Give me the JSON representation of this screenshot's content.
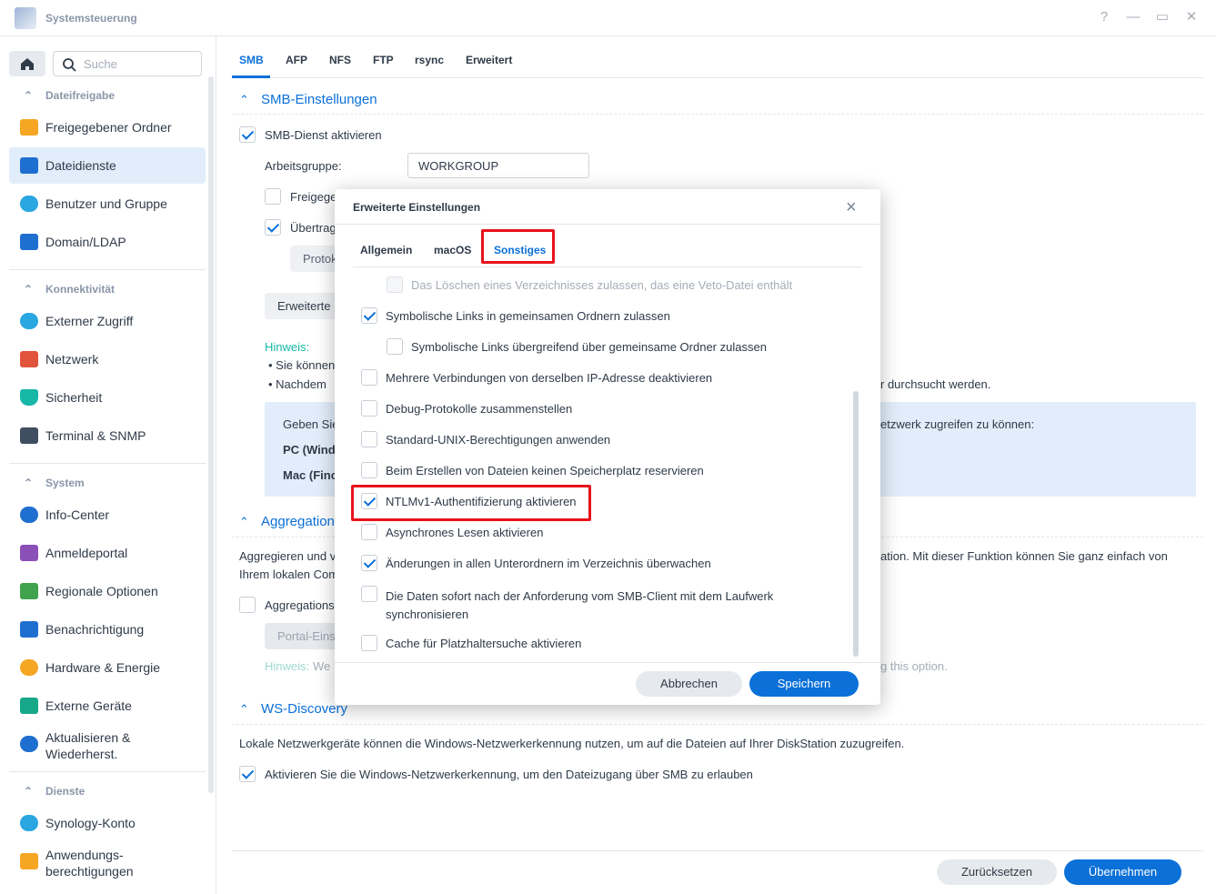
{
  "window": {
    "title": "Systemsteuerung",
    "controls": [
      "?",
      "—",
      "▭",
      "✕"
    ]
  },
  "sidebar": {
    "search_placeholder": "Suche",
    "sections": [
      {
        "label": "Dateifreigabe"
      },
      {
        "label": "Konnektivität"
      },
      {
        "label": "System"
      },
      {
        "label": "Dienste"
      }
    ],
    "items": [
      {
        "label": "Freigegebener Ordner",
        "icon": "folder-icon",
        "color": "#f5a623"
      },
      {
        "label": "Dateidienste",
        "icon": "file-services-icon",
        "color": "#1f6fd0"
      },
      {
        "label": "Benutzer und Gruppe",
        "icon": "users-icon",
        "color": "#2aa6e0"
      },
      {
        "label": "Domain/LDAP",
        "icon": "domain-icon",
        "color": "#1f6fd0"
      },
      {
        "label": "Externer Zugriff",
        "icon": "external-access-icon",
        "color": "#2aa6e0"
      },
      {
        "label": "Netzwerk",
        "icon": "network-home-icon",
        "color": "#e2533c"
      },
      {
        "label": "Sicherheit",
        "icon": "shield-icon",
        "color": "#17b8a6"
      },
      {
        "label": "Terminal & SNMP",
        "icon": "terminal-icon",
        "color": "#3f4e60"
      },
      {
        "label": "Info-Center",
        "icon": "info-icon",
        "color": "#1f6fd0"
      },
      {
        "label": "Anmeldeportal",
        "icon": "login-portal-icon",
        "color": "#8b4fb8"
      },
      {
        "label": "Regionale Optionen",
        "icon": "region-map-icon",
        "color": "#3fa34d"
      },
      {
        "label": "Benachrichtigung",
        "icon": "notification-icon",
        "color": "#1f6fd0"
      },
      {
        "label": "Hardware & Energie",
        "icon": "lightbulb-icon",
        "color": "#f5a623"
      },
      {
        "label": "Externe Geräte",
        "icon": "external-device-icon",
        "color": "#17a88a"
      },
      {
        "label": "Aktualisieren & Wiederherst.",
        "icon": "update-icon",
        "color": "#1f6fd0"
      },
      {
        "label": "Synology-Konto",
        "icon": "account-icon",
        "color": "#2aa6e0"
      },
      {
        "label": "Anwendungs-berechtigungen",
        "icon": "lock-icon",
        "color": "#f5a623"
      }
    ]
  },
  "tabs": [
    "SMB",
    "AFP",
    "NFS",
    "FTP",
    "rsync",
    "Erweitert"
  ],
  "smb": {
    "header": "SMB-Einstellungen",
    "enable": "SMB-Dienst aktivieren",
    "workgroup_label": "Arbeitsgruppe:",
    "workgroup_value": "WORKGROUP",
    "cb2": "Freigege",
    "cb3": "Übertrag",
    "protocol_btn": "Protok",
    "advanced_btn": "Erweiterte",
    "hint_label": "Hinweis:",
    "hint1": "Sie können",
    "hint2": "Nachdem",
    "hint2_tail": "r durchsucht werden.",
    "info_line1": "Geben Sie",
    "info_line1_tail": "etzwerk zugreifen zu können:",
    "info_pc": "PC (Wind",
    "info_mac": "Mac (Finc"
  },
  "aggregation": {
    "header": "Aggregation",
    "desc_start": "Aggregieren und v",
    "desc_tail": "ation. Mit dieser Funktion können Sie ganz einfach von",
    "desc_line2": "Ihrem lokalen Com",
    "cb": "Aggregations",
    "portal_btn": "Portal-Eins",
    "hint_label": "Hinweis:",
    "hint_text": "We",
    "hint_tail": "g this option."
  },
  "wsd": {
    "header": "WS-Discovery",
    "desc": "Lokale Netzwerkgeräte können die Windows-Netzwerkerkennung nutzen, um auf die Dateien auf Ihrer DiskStation zuzugreifen.",
    "enable": "Aktivieren Sie die Windows-Netzwerkerkennung, um den Dateizugang über SMB zu erlauben"
  },
  "footer": {
    "reset": "Zurücksetzen",
    "apply": "Übernehmen"
  },
  "modal": {
    "title": "Erweiterte Einstellungen",
    "tabs": [
      "Allgemein",
      "macOS",
      "Sonstiges"
    ],
    "options": [
      {
        "label": "Das Löschen eines Verzeichnisses zulassen, das eine Veto-Datei enthält",
        "checked": false,
        "disabled": true,
        "indent": true
      },
      {
        "label": "Symbolische Links in gemeinsamen Ordnern zulassen",
        "checked": true,
        "disabled": false,
        "indent": false
      },
      {
        "label": "Symbolische Links übergreifend über gemeinsame Ordner zulassen",
        "checked": false,
        "disabled": false,
        "indent": true
      },
      {
        "label": "Mehrere Verbindungen von derselben IP-Adresse deaktivieren",
        "checked": false,
        "disabled": false,
        "indent": false
      },
      {
        "label": "Debug-Protokolle zusammenstellen",
        "checked": false,
        "disabled": false,
        "indent": false
      },
      {
        "label": "Standard-UNIX-Berechtigungen anwenden",
        "checked": false,
        "disabled": false,
        "indent": false
      },
      {
        "label": "Beim Erstellen von Dateien keinen Speicherplatz reservieren",
        "checked": false,
        "disabled": false,
        "indent": false
      },
      {
        "label": "NTLMv1-Authentifizierung aktivieren",
        "checked": true,
        "disabled": false,
        "indent": false
      },
      {
        "label": "Asynchrones Lesen aktivieren",
        "checked": false,
        "disabled": false,
        "indent": false
      },
      {
        "label": "Änderungen in allen Unterordnern im Verzeichnis überwachen",
        "checked": true,
        "disabled": false,
        "indent": false
      },
      {
        "label": "Die Daten sofort nach der Anforderung vom SMB-Client mit dem Laufwerk synchronisieren",
        "checked": false,
        "disabled": false,
        "indent": false
      },
      {
        "label": "Cache für Platzhaltersuche aktivieren",
        "checked": false,
        "disabled": false,
        "indent": false
      }
    ],
    "cancel": "Abbrechen",
    "save": "Speichern"
  },
  "colors": {
    "accent": "#0b70d8",
    "highlight": "#e8121b"
  }
}
